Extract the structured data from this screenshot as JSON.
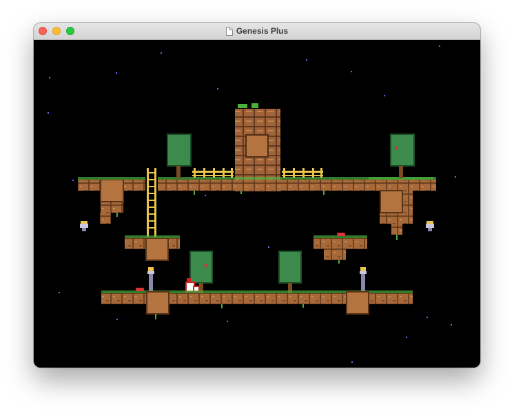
{
  "window": {
    "title": "Genesis Plus"
  },
  "icons": {
    "close": "close-button",
    "minimize": "minimize-button",
    "maximize": "zoom-button",
    "document": "document-icon"
  },
  "colors": {
    "sky": "#000000",
    "dirt": "#a8693a",
    "dirt_dark": "#5a3418",
    "grass": "#4caf3a",
    "tree": "#3c8a4c",
    "ladder": "#e9c54a",
    "star": "#6b6bff"
  }
}
